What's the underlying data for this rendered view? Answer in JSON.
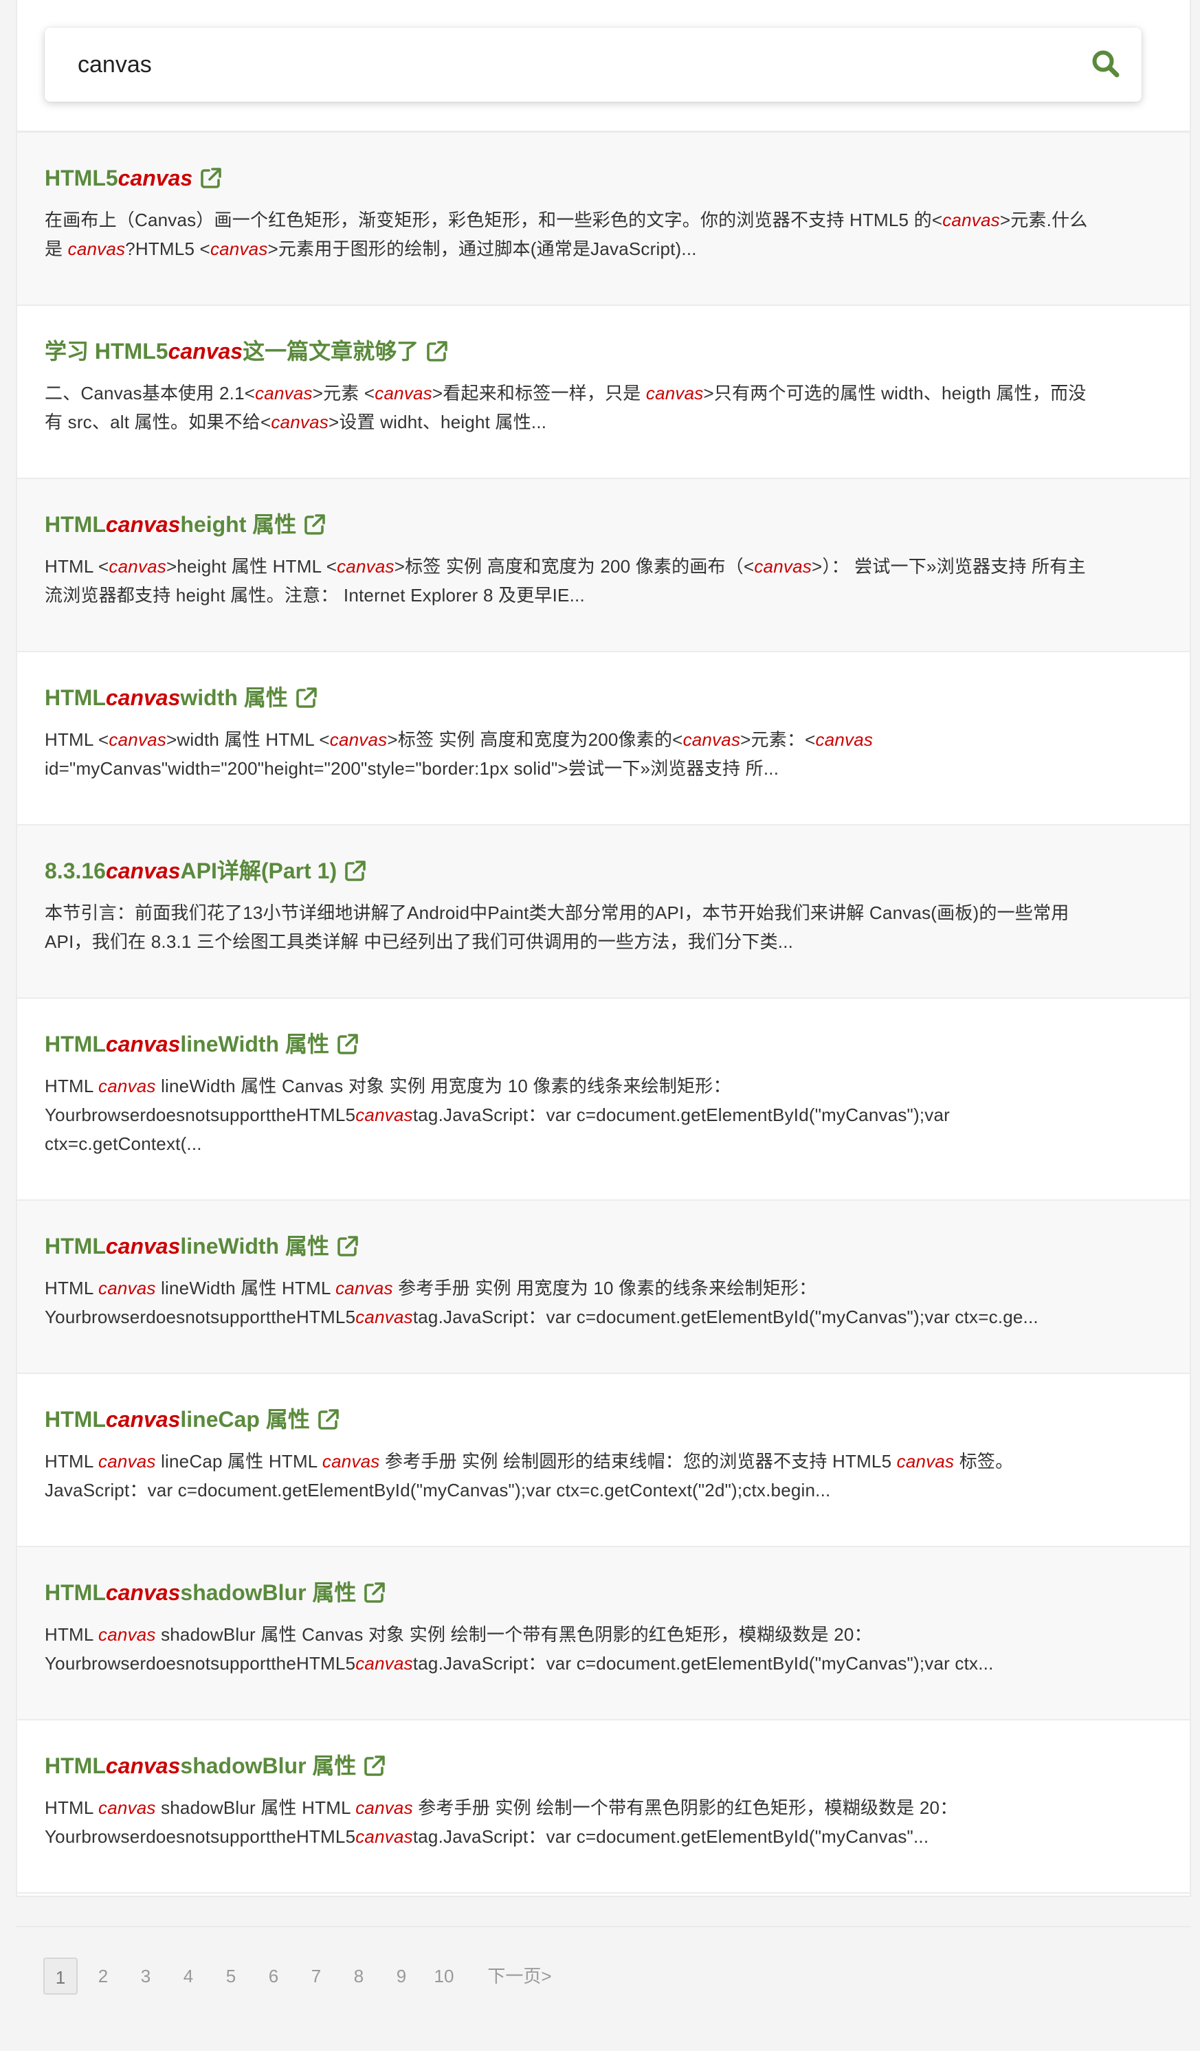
{
  "search": {
    "value": "canvas"
  },
  "results": [
    {
      "title": [
        [
          "HTML5 ",
          0
        ],
        [
          "canvas",
          1
        ]
      ],
      "lines": [
        [
          [
            "在画布上（Canvas）画一个红色矩形，渐变矩形，彩色矩形，和一些彩色的文字。你的浏览器不支持 HTML5 的<",
            0
          ],
          [
            "canvas",
            1
          ],
          [
            ">元素.什么",
            0
          ]
        ],
        [
          [
            "是 ",
            0
          ],
          [
            "canvas",
            1
          ],
          [
            "?HTML5 <",
            0
          ],
          [
            "canvas",
            1
          ],
          [
            ">元素用于图形的绘制，通过脚本(通常是JavaScript)...",
            0
          ]
        ]
      ]
    },
    {
      "title": [
        [
          "学习 HTML5 ",
          0
        ],
        [
          "canvas",
          1
        ],
        [
          " 这一篇文章就够了",
          0
        ]
      ],
      "lines": [
        [
          [
            "二、Canvas基本使用 2.1<",
            0
          ],
          [
            "canvas",
            1
          ],
          [
            ">元素 <",
            0
          ],
          [
            "canvas",
            1
          ],
          [
            ">看起来和标签一样，只是 ",
            0
          ],
          [
            "canvas",
            1
          ],
          [
            ">只有两个可选的属性 width、heigth 属性，而没",
            0
          ]
        ],
        [
          [
            "有 src、alt 属性。如果不给<",
            0
          ],
          [
            "canvas",
            1
          ],
          [
            ">设置 widht、height 属性...",
            0
          ]
        ]
      ]
    },
    {
      "title": [
        [
          "HTML ",
          0
        ],
        [
          "canvas",
          1
        ],
        [
          " height 属性",
          0
        ]
      ],
      "lines": [
        [
          [
            "HTML <",
            0
          ],
          [
            "canvas",
            1
          ],
          [
            ">height 属性 HTML <",
            0
          ],
          [
            "canvas",
            1
          ],
          [
            ">标签 实例 高度和宽度为 200 像素的画布（<",
            0
          ],
          [
            "canvas",
            1
          ],
          [
            ">）： 尝试一下»浏览器支持 所有主",
            0
          ]
        ],
        [
          [
            "流浏览器都支持 height 属性。注意： Internet Explorer 8 及更早IE...",
            0
          ]
        ]
      ]
    },
    {
      "title": [
        [
          "HTML ",
          0
        ],
        [
          "canvas",
          1
        ],
        [
          " width 属性",
          0
        ]
      ],
      "lines": [
        [
          [
            "HTML <",
            0
          ],
          [
            "canvas",
            1
          ],
          [
            ">width 属性 HTML <",
            0
          ],
          [
            "canvas",
            1
          ],
          [
            ">标签 实例 高度和宽度为200像素的<",
            0
          ],
          [
            "canvas",
            1
          ],
          [
            ">元素：<",
            0
          ],
          [
            "canvas",
            1
          ]
        ],
        [
          [
            "id=\"myCanvas\"width=\"200\"height=\"200\"style=\"border:1px solid\">尝试一下»浏览器支持 所...",
            0
          ]
        ]
      ]
    },
    {
      "title": [
        [
          "8.3.16 ",
          0
        ],
        [
          "canvas",
          1
        ],
        [
          " API详解(Part 1)",
          0
        ]
      ],
      "lines": [
        [
          [
            "本节引言：前面我们花了13小节详细地讲解了Android中Paint类大部分常用的API，本节开始我们来讲解 Canvas(画板)的一些常用",
            0
          ]
        ],
        [
          [
            "API，我们在 8.3.1 三个绘图工具类详解 中已经列出了我们可供调用的一些方法，我们分下类...",
            0
          ]
        ]
      ]
    },
    {
      "title": [
        [
          "HTML ",
          0
        ],
        [
          "canvas",
          1
        ],
        [
          " lineWidth 属性",
          0
        ]
      ],
      "lines": [
        [
          [
            "HTML ",
            0
          ],
          [
            "canvas",
            1
          ],
          [
            " lineWidth 属性 Canvas 对象 实例 用宽度为 10 像素的线条来绘制矩形：",
            0
          ]
        ],
        [
          [
            "YourbrowserdoesnotsupporttheHTML5",
            0
          ],
          [
            "canvas",
            1
          ],
          [
            "tag.JavaScript：var c=document.getElementById(\"myCanvas\");var",
            0
          ]
        ],
        [
          [
            "ctx=c.getContext(...",
            0
          ]
        ]
      ]
    },
    {
      "title": [
        [
          "HTML ",
          0
        ],
        [
          "canvas",
          1
        ],
        [
          " lineWidth 属性",
          0
        ]
      ],
      "lines": [
        [
          [
            "HTML ",
            0
          ],
          [
            "canvas",
            1
          ],
          [
            " lineWidth 属性 HTML ",
            0
          ],
          [
            "canvas",
            1
          ],
          [
            " 参考手册 实例 用宽度为 10 像素的线条来绘制矩形：",
            0
          ]
        ],
        [
          [
            "YourbrowserdoesnotsupporttheHTML5",
            0
          ],
          [
            "canvas",
            1
          ],
          [
            "tag.JavaScript：var c=document.getElementById(\"myCanvas\");var ctx=c.ge...",
            0
          ]
        ]
      ]
    },
    {
      "title": [
        [
          "HTML ",
          0
        ],
        [
          "canvas",
          1
        ],
        [
          " lineCap 属性",
          0
        ]
      ],
      "lines": [
        [
          [
            "HTML ",
            0
          ],
          [
            "canvas",
            1
          ],
          [
            " lineCap 属性 HTML ",
            0
          ],
          [
            "canvas",
            1
          ],
          [
            " 参考手册 实例 绘制圆形的结束线帽：您的浏览器不支持 HTML5 ",
            0
          ],
          [
            "canvas",
            1
          ],
          [
            " 标签。",
            0
          ]
        ],
        [
          [
            "JavaScript：var c=document.getElementById(\"myCanvas\");var ctx=c.getContext(\"2d\");ctx.begin...",
            0
          ]
        ]
      ]
    },
    {
      "title": [
        [
          "HTML ",
          0
        ],
        [
          "canvas",
          1
        ],
        [
          " shadowBlur 属性",
          0
        ]
      ],
      "lines": [
        [
          [
            "HTML ",
            0
          ],
          [
            "canvas",
            1
          ],
          [
            " shadowBlur 属性 Canvas 对象 实例 绘制一个带有黑色阴影的红色矩形，模糊级数是 20：",
            0
          ]
        ],
        [
          [
            "YourbrowserdoesnotsupporttheHTML5",
            0
          ],
          [
            "canvas",
            1
          ],
          [
            "tag.JavaScript：var c=document.getElementById(\"myCanvas\");var ctx...",
            0
          ]
        ]
      ]
    },
    {
      "title": [
        [
          "HTML ",
          0
        ],
        [
          "canvas",
          1
        ],
        [
          " shadowBlur 属性",
          0
        ]
      ],
      "lines": [
        [
          [
            "HTML ",
            0
          ],
          [
            "canvas",
            1
          ],
          [
            " shadowBlur 属性 HTML ",
            0
          ],
          [
            "canvas",
            1
          ],
          [
            " 参考手册 实例 绘制一个带有黑色阴影的红色矩形，模糊级数是 20：",
            0
          ]
        ],
        [
          [
            "YourbrowserdoesnotsupporttheHTML5",
            0
          ],
          [
            "canvas",
            1
          ],
          [
            "tag.JavaScript：var c=document.getElementById(\"myCanvas\"...",
            0
          ]
        ]
      ]
    }
  ],
  "pagination": {
    "pages": [
      "1",
      "2",
      "3",
      "4",
      "5",
      "6",
      "7",
      "8",
      "9",
      "10"
    ],
    "current": "1",
    "next_label": "下一页>"
  },
  "colors": {
    "title": "#5a8a3c",
    "keyword": "#cc0000",
    "text": "#333333",
    "icon": "#5a8a3c"
  },
  "icons": {
    "search": "search-icon",
    "external": "external-link-icon"
  }
}
